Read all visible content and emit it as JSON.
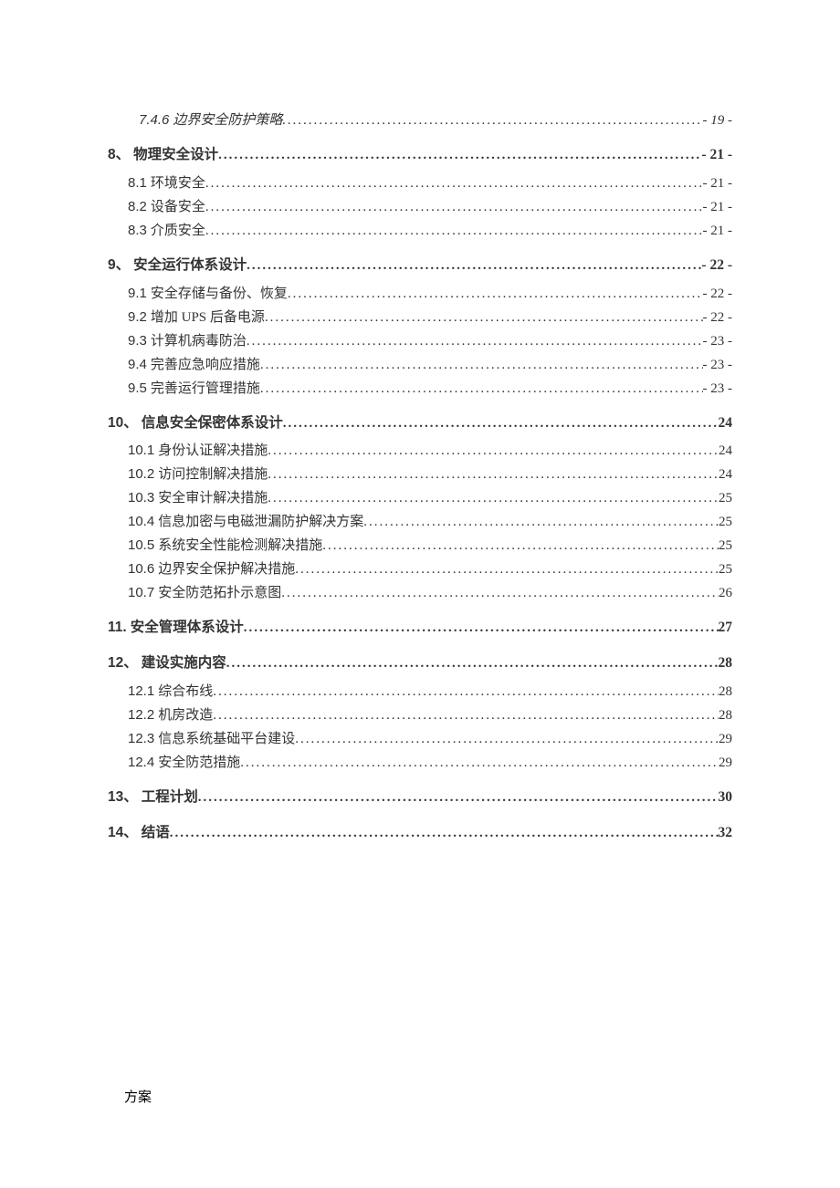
{
  "toc": [
    {
      "level": 3,
      "num": "7.4.6",
      "title": "边界安全防护策略",
      "page": "- 19 -"
    },
    {
      "level": 1,
      "num": "8、",
      "title": "物理安全设计",
      "page": "- 21 -"
    },
    {
      "level": 2,
      "num": "8.1",
      "title": "环境安全",
      "page": "- 21 -"
    },
    {
      "level": 2,
      "num": "8.2",
      "title": "设备安全",
      "page": "- 21 -"
    },
    {
      "level": 2,
      "num": "8.3",
      "title": "介质安全",
      "page": "- 21 -"
    },
    {
      "level": 1,
      "num": "9、",
      "title": "安全运行体系设计",
      "page": "- 22 -"
    },
    {
      "level": 2,
      "num": "9.1",
      "title": "安全存储与备份、恢复",
      "page": "- 22 -"
    },
    {
      "level": 2,
      "num": "9.2",
      "title": "增加 UPS 后备电源",
      "page": "- 22 -"
    },
    {
      "level": 2,
      "num": "9.3",
      "title": "计算机病毒防治",
      "page": "- 23 -"
    },
    {
      "level": 2,
      "num": "9.4",
      "title": "完善应急响应措施",
      "page": "- 23 -"
    },
    {
      "level": 2,
      "num": "9.5",
      "title": "完善运行管理措施",
      "page": "- 23 -"
    },
    {
      "level": 1,
      "num": "10、",
      "title": "信息安全保密体系设计",
      "page": "24"
    },
    {
      "level": 2,
      "num": "10.1",
      "title": "身份认证解决措施",
      "page": "24"
    },
    {
      "level": 2,
      "num": "10.2",
      "title": "访问控制解决措施",
      "page": "24"
    },
    {
      "level": 2,
      "num": "10.3",
      "title": "安全审计解决措施",
      "page": "25"
    },
    {
      "level": 2,
      "num": "10.4",
      "title": "信息加密与电磁泄漏防护解决方案",
      "page": "25"
    },
    {
      "level": 2,
      "num": "10.5",
      "title": "系统安全性能检测解决措施",
      "page": "25"
    },
    {
      "level": 2,
      "num": "10.6",
      "title": "边界安全保护解决措施",
      "page": "25"
    },
    {
      "level": 2,
      "num": "10.7",
      "title": "安全防范拓扑示意图",
      "page": "26"
    },
    {
      "level": 1,
      "num": "11.",
      "title": "安全管理体系设计",
      "page": "27"
    },
    {
      "level": 1,
      "num": "12、",
      "title": "建设实施内容",
      "page": "28"
    },
    {
      "level": 2,
      "num": "12.1",
      "title": "综合布线",
      "page": "28"
    },
    {
      "level": 2,
      "num": "12.2",
      "title": "机房改造",
      "page": "28"
    },
    {
      "level": 2,
      "num": "12.3",
      "title": "信息系统基础平台建设",
      "page": "29"
    },
    {
      "level": 2,
      "num": "12.4",
      "title": "安全防范措施",
      "page": "29"
    },
    {
      "level": 1,
      "num": "13、",
      "title": "工程计划",
      "page": "30"
    },
    {
      "level": 1,
      "num": "14、",
      "title": "结语",
      "page": "32"
    }
  ],
  "footer": "方案"
}
